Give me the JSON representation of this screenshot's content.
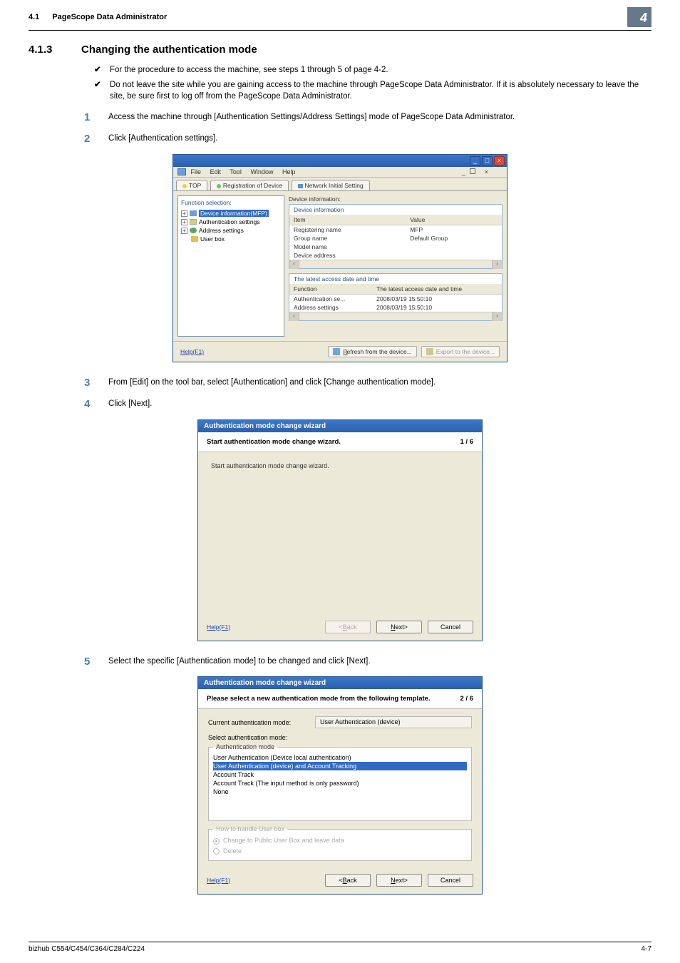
{
  "header": {
    "section_number": "4.1",
    "section_title": "PageScope Data Administrator",
    "chapter_number": "4"
  },
  "h413": {
    "number": "4.1.3",
    "title": "Changing the authentication mode"
  },
  "checks": [
    "For the procedure to access the machine, see steps 1 through 5 of page 4-2.",
    "Do not leave the site while you are gaining access to the machine through PageScope Data Administrator. If it is absolutely necessary to leave the site, be sure first to log off from the PageScope Data Administrator."
  ],
  "steps": {
    "s1": "Access the machine through [Authentication Settings/Address Settings] mode of PageScope Data Administrator.",
    "s2": "Click [Authentication settings].",
    "s3": "From [Edit] on the tool bar, select [Authentication] and click [Change authentication mode].",
    "s4": "Click [Next].",
    "s5": "Select the specific [Authentication mode] to be changed and click [Next]."
  },
  "fig1": {
    "menu": {
      "file": "File",
      "edit": "Edit",
      "tool": "Tool",
      "window": "Window",
      "help": "Help"
    },
    "restore_suffix": "×",
    "tabs": {
      "top": "TOP",
      "reg": "Registration of Device",
      "net": "Network Initial Setting"
    },
    "left": {
      "title": "Function selection:",
      "items": {
        "devinfo": "Device information(MFP)",
        "auth": "Authentication settings",
        "addr": "Address settings",
        "ubox": "User box"
      }
    },
    "right": {
      "top_label": "Device information:",
      "group1_title": "Device information",
      "col_item": "Item",
      "col_value": "Value",
      "rows1": {
        "r1k": "Registering name",
        "r1v": "MFP",
        "r2k": "Group name",
        "r2v": "Default Group",
        "r3k": "Model name",
        "r4k": "Device address"
      },
      "group2_title": "The latest access date and time",
      "col_func": "Function",
      "col_latest": "The latest access date and time",
      "rows2": {
        "r1k": "Authentication se...",
        "r1v": "2008/03/19 15:50:10",
        "r2k": "Address settings",
        "r2v": "2008/03/19 15:50:10"
      }
    },
    "help": "Help(F1)",
    "btn_refresh": "Refresh from the device...",
    "btn_export": "Export to the device..."
  },
  "fig2": {
    "title": "Authentication mode change wizard",
    "head": "Start authentication mode change wizard.",
    "page": "1 / 6",
    "body": "Start authentication mode change wizard.",
    "help": "Help(F1)",
    "back": "<Back",
    "next": "Next>",
    "cancel": "Cancel"
  },
  "fig3": {
    "title": "Authentication mode change wizard",
    "head": "Please select a new authentication mode from the following template.",
    "page": "2 / 6",
    "cur_label": "Current authentication mode:",
    "cur_value": "User Authentication (device)",
    "sel_label": "Select authentication mode:",
    "fs1_legend": "Authentication mode",
    "fs1_opts": {
      "o1": "User Authentication (Device local authentication)",
      "o2": "User Authentication (device) and Account Tracking",
      "o3": "Account Track",
      "o4": "Account Track (The input method is only password)",
      "o5": "None"
    },
    "fs2_legend": "How to handle User box",
    "fs2_o1": "Change to Public User Box and leave data",
    "fs2_o2": "Delete",
    "help": "Help(F1)",
    "back": "<Back",
    "next": "Next>",
    "cancel": "Cancel"
  },
  "footer": {
    "left": "bizhub C554/C454/C364/C284/C224",
    "right": "4-7"
  }
}
